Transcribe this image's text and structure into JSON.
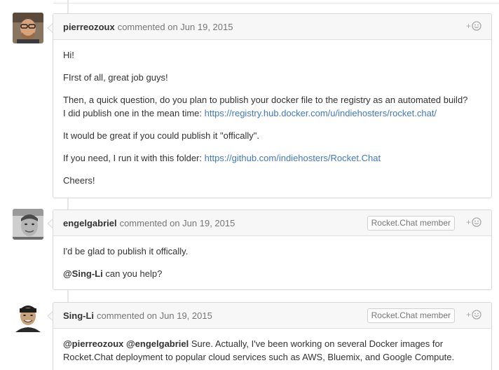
{
  "comments": [
    {
      "author": "pierreozoux",
      "meta": "commented on Jun 19, 2015",
      "avatar_icon": "avatar-pierreozoux",
      "paragraphs": {
        "p1": "Hi!",
        "p2": "FIrst of all, great job guys!",
        "p3a": "Then, a quick question, do you plan to publish your docker file to the registry as an automated build?",
        "p3b": "I did publish one in the mean time: ",
        "p3link": "https://registry.hub.docker.com/u/indiehosters/rocket.chat/",
        "p4": "It would be great if you could publish it \"offically\".",
        "p5": "If you need, I run it with this folder: ",
        "p5link": "https://github.com/indiehosters/Rocket.Chat",
        "p6": "Cheers!"
      }
    },
    {
      "author": "engelgabriel",
      "meta": "commented on Jun 19, 2015",
      "badge": "Rocket.Chat member",
      "avatar_icon": "avatar-engelgabriel",
      "paragraphs": {
        "p1": "I'd be glad to publish it offically.",
        "p2mention": "@Sing-Li",
        "p2": " can you help?"
      }
    },
    {
      "author": "Sing-Li",
      "meta": "commented on Jun 19, 2015",
      "badge": "Rocket.Chat member",
      "avatar_icon": "avatar-sing-li",
      "paragraphs": {
        "m1": "@pierreozoux",
        "m2": "@engelgabriel",
        "p1": " Sure. Actually, I've been working on several Docker images for",
        "p2": "Rocket.Chat deployment to popular cloud services such as AWS, Bluemix, and Google Compute."
      }
    }
  ],
  "reaction_icon": "add-reaction-icon",
  "colors": {
    "link": "#4078c0",
    "header_bg": "#f7f7f7",
    "border": "#d8d8d8"
  }
}
